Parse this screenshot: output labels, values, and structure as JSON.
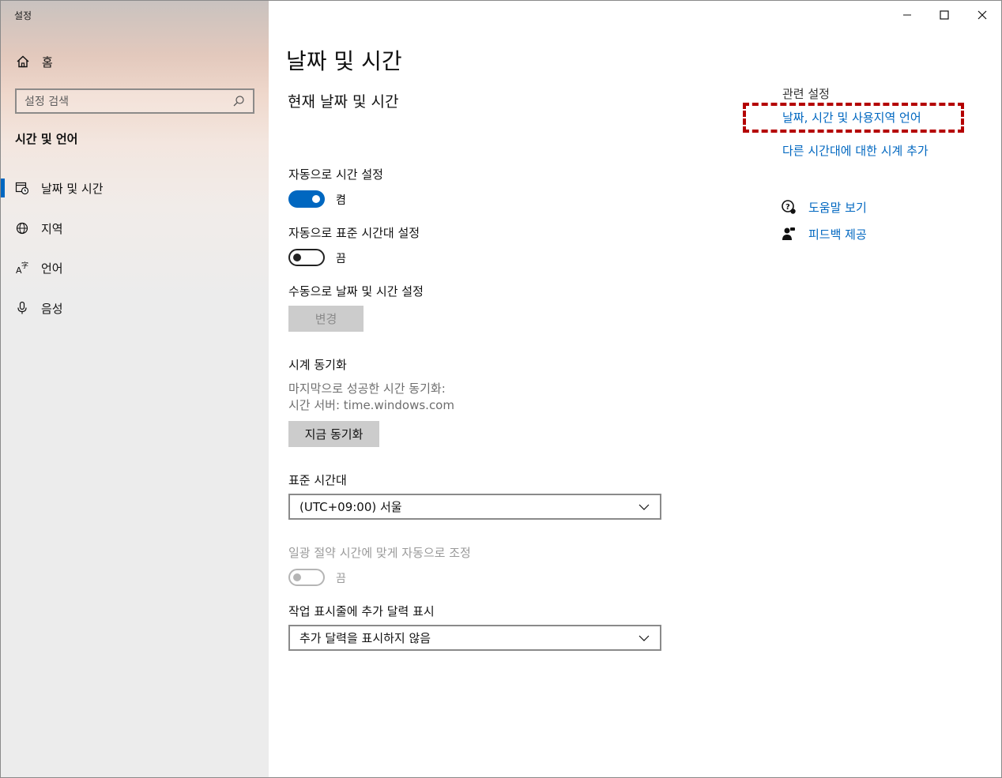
{
  "window": {
    "title": "설정",
    "controls": {
      "minimize_icon": "minimize-icon",
      "maximize_icon": "maximize-icon",
      "close_icon": "close-icon"
    }
  },
  "sidebar": {
    "home_label": "홈",
    "search_placeholder": "설정 검색",
    "section_title": "시간 및 언어",
    "items": [
      {
        "label": "날짜 및 시간",
        "icon": "calendar-clock-icon",
        "active": true
      },
      {
        "label": "지역",
        "icon": "globe-icon",
        "active": false
      },
      {
        "label": "언어",
        "icon": "language-icon",
        "active": false
      },
      {
        "label": "음성",
        "icon": "microphone-icon",
        "active": false
      }
    ]
  },
  "main": {
    "page_title": "날짜 및 시간",
    "current_heading": "현재 날짜 및 시간",
    "auto_time": {
      "label": "자동으로 시간 설정",
      "state_text": "켬",
      "on": true
    },
    "auto_timezone": {
      "label": "자동으로 표준 시간대 설정",
      "state_text": "끔",
      "on": false
    },
    "manual": {
      "label": "수동으로 날짜 및 시간 설정",
      "button": "변경"
    },
    "sync": {
      "heading": "시계 동기화",
      "last_sync": "마지막으로 성공한 시간 동기화:",
      "server": "시간 서버: time.windows.com",
      "button": "지금 동기화"
    },
    "timezone": {
      "label": "표준 시간대",
      "value": "(UTC+09:00) 서울"
    },
    "dst": {
      "label": "일광 절약 시간에 맞게 자동으로 조정",
      "state_text": "끔",
      "enabled": false
    },
    "taskbar_calendar": {
      "label": "작업 표시줄에 추가 달력 표시",
      "value": "추가 달력을 표시하지 않음"
    }
  },
  "related": {
    "title": "관련 설정",
    "links": [
      "날짜, 시간 및 사용지역 언어",
      "다른 시간대에 대한 시계 추가"
    ],
    "help": "도움말 보기",
    "feedback": "피드백 제공"
  },
  "colors": {
    "accent": "#0067c0",
    "highlight": "#b40000"
  }
}
